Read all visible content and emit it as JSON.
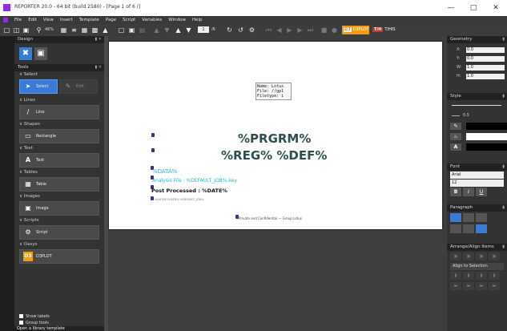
{
  "window": {
    "title": "REPORTER 20.0 - 64 bit (build 2580) - [Page 1 of 6 /]",
    "minimize": "—",
    "maximize": "□",
    "close": "✕"
  },
  "menu": [
    "File",
    "Edit",
    "View",
    "Insert",
    "Template",
    "Page",
    "Script",
    "Variables",
    "Window",
    "Help"
  ],
  "toolbar": {
    "zoom": "46%",
    "page_current": "1",
    "page_total": "/6",
    "d3plot_label": "D3PLOT",
    "t_his_label": "T/HIS"
  },
  "left_panel": {
    "design_title": "Design",
    "tools_title": "Tools",
    "categories": {
      "select": "Select",
      "lines": "Lines",
      "shapes": "Shapes",
      "text": "Text",
      "tables": "Tables",
      "images": "Images",
      "scripts": "Scripts",
      "oasys": "Oasys"
    },
    "tools": {
      "select": "Select",
      "edit": "Edit",
      "line": "Line",
      "rectangle": "Rectangle",
      "text": "Text",
      "table": "Table",
      "image": "Image",
      "script": "Script",
      "d3plot": "D3PLOT"
    },
    "show_labels": "Show labels",
    "group_tools": "Group tools",
    "status": "Open a library template"
  },
  "page": {
    "logo_text": "Name: Lotus\nFile: //gp1\nFiletype: i",
    "line1": "%PRGRM%",
    "line2": "%REG% %DEF%",
    "data": "%DATA%",
    "analysis": "Analysis File : %DEFAULT_JOB%.key",
    "post": "Post Processed : %DATE%",
    "small": "%AUTHFOLDER%  %DEFAULT_JOB%",
    "footer": "Private and Confidential — Group Lotus"
  },
  "right_panel": {
    "geometry_title": "Geometry",
    "geometry": [
      {
        "label": "X:",
        "value": "0.0"
      },
      {
        "label": "Y:",
        "value": "0.0"
      },
      {
        "label": "W:",
        "value": "1.0"
      },
      {
        "label": "H:",
        "value": "1.0"
      }
    ],
    "style_title": "Style",
    "line_width": "0.5",
    "font_title": "Font",
    "font_name": "Arial",
    "font_size": "12",
    "bold": "B",
    "italic": "I",
    "underline": "U",
    "paragraph_title": "Paragraph",
    "arrange_title": "Arrange/Align Items",
    "align_to": "Align to Selection"
  }
}
